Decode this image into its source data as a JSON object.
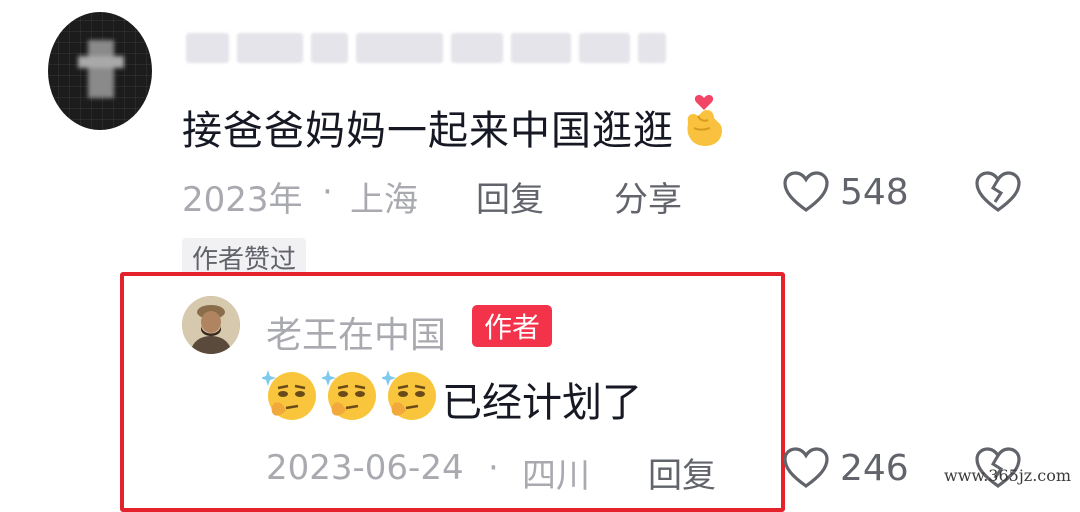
{
  "comment": {
    "text": "接爸爸妈妈一起来中国逛逛",
    "emoji": "finger-heart",
    "date": "2023年",
    "separator": "·",
    "location": "上海",
    "reply_label": "回复",
    "share_label": "分享",
    "like_count": "548",
    "author_liked_label": "作者赞过"
  },
  "reply": {
    "username": "老王在中国",
    "author_badge": "作者",
    "emojis": [
      "thinking-face",
      "thinking-face",
      "thinking-face"
    ],
    "text": "已经计划了",
    "date": "2023-06-24",
    "separator": "·",
    "location": "四川",
    "reply_label": "回复",
    "like_count": "246"
  },
  "watermark": "www.365jz.com",
  "colors": {
    "highlight_border": "#e3222c",
    "author_badge": "#f2334a",
    "primary_text": "#161823",
    "secondary_text": "#a9aab0"
  }
}
